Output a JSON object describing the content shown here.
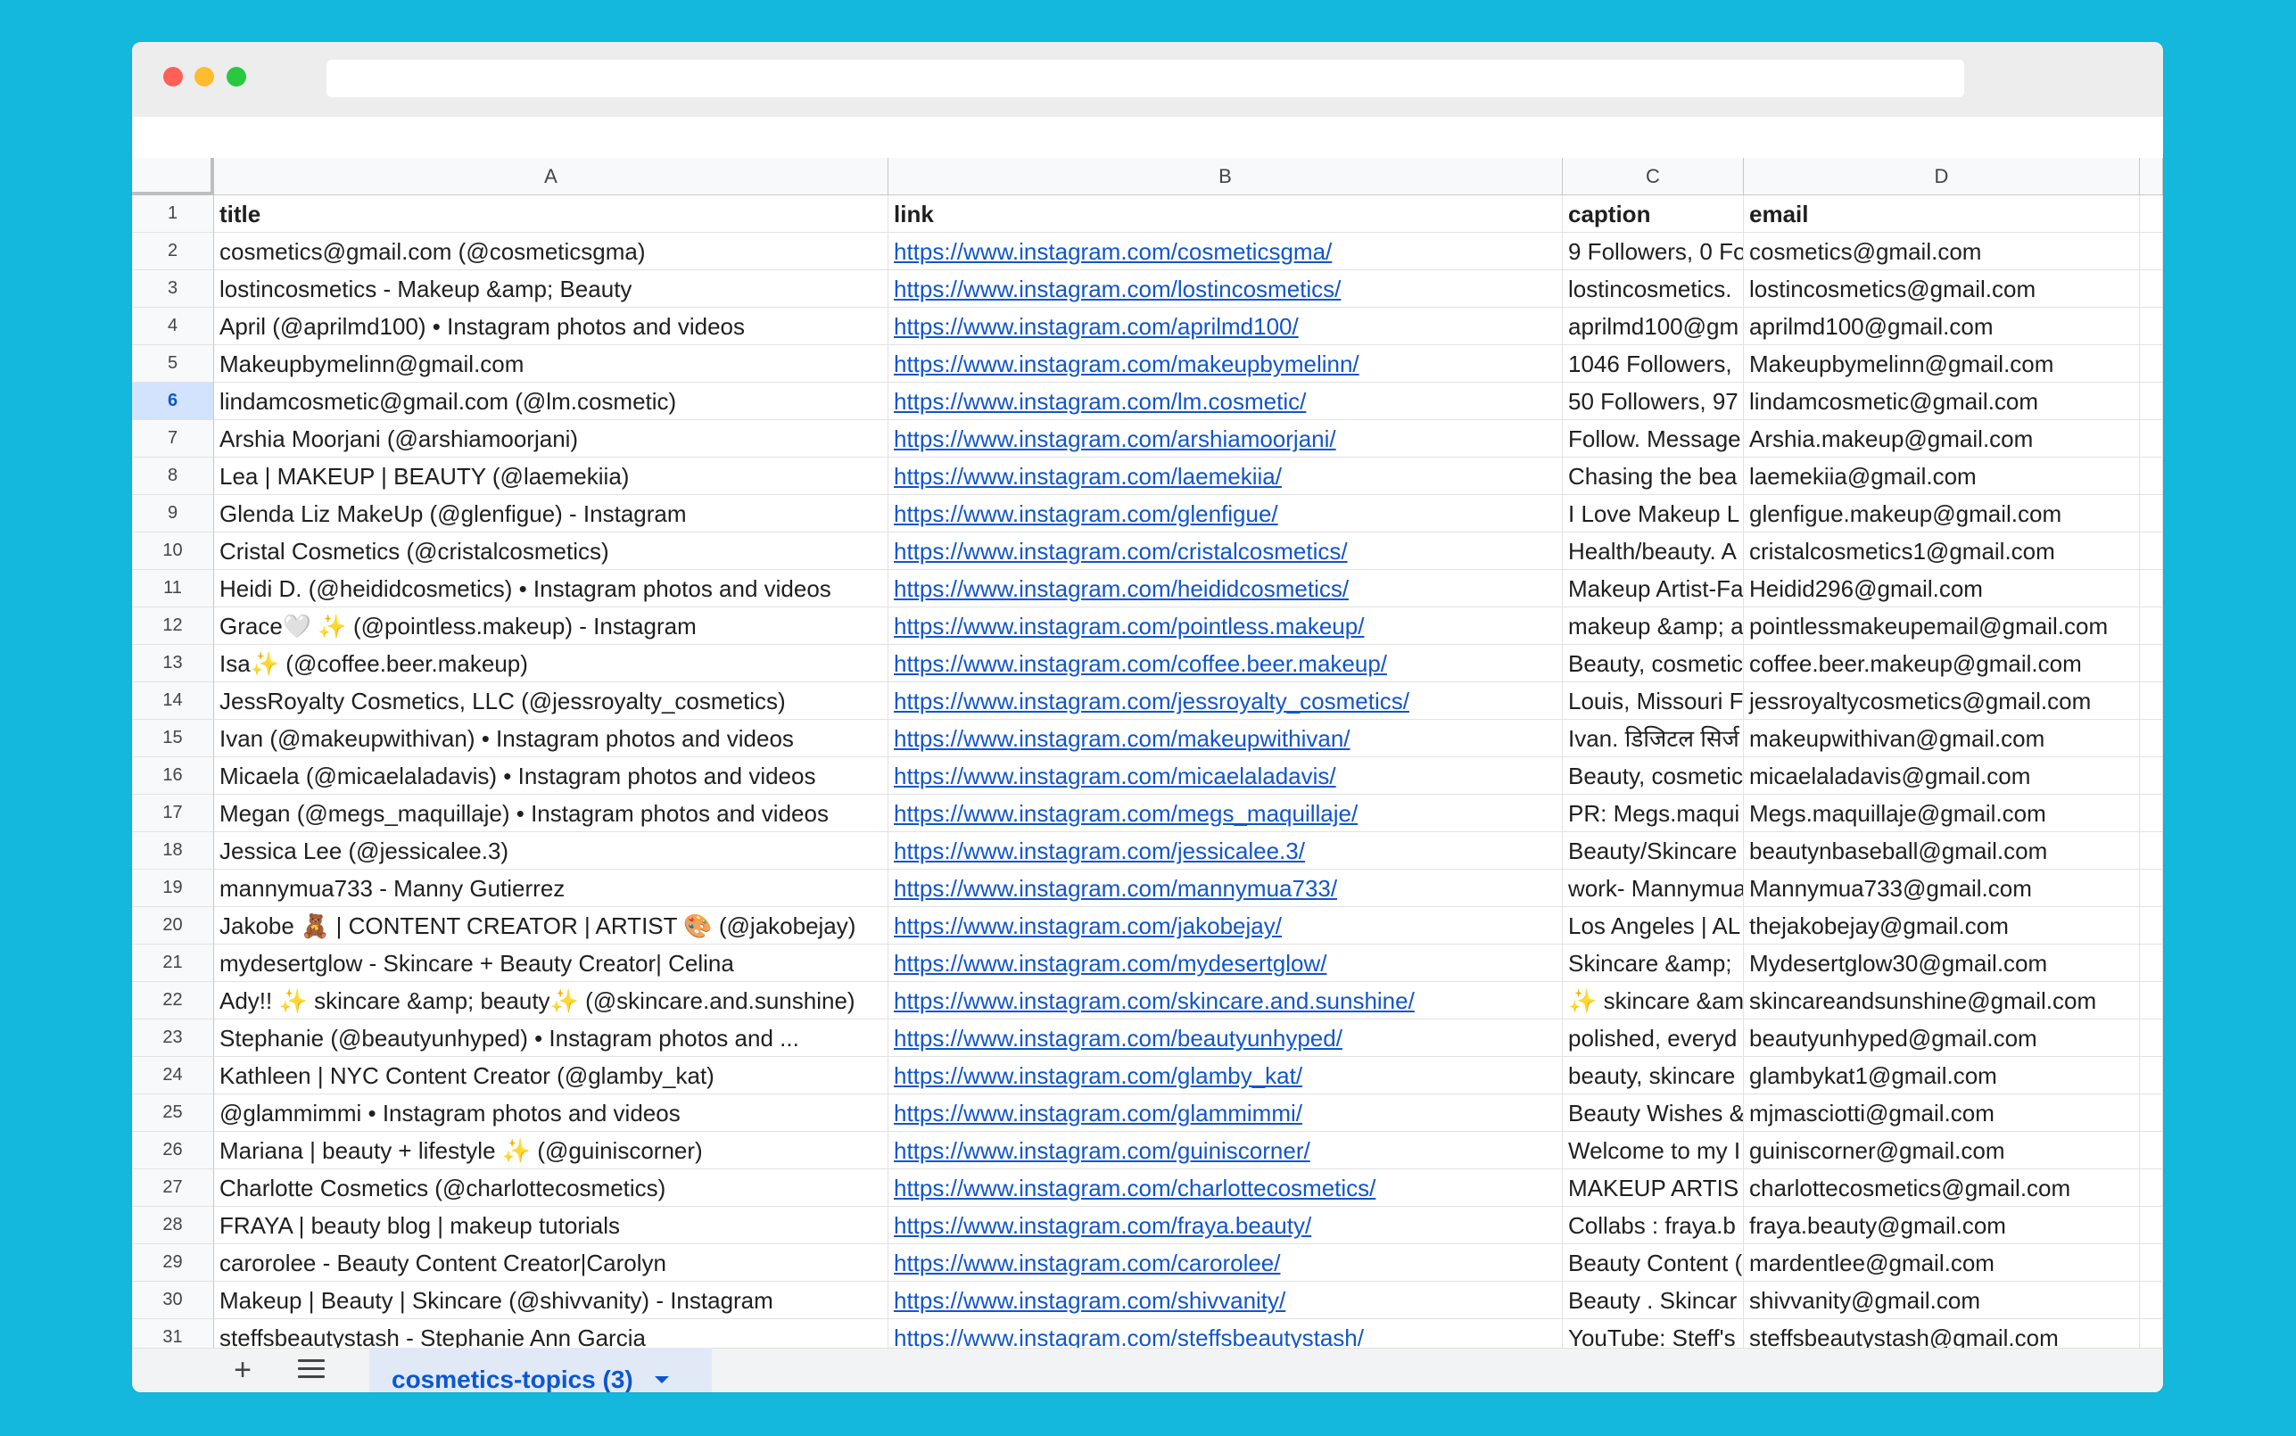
{
  "sheet": {
    "columns": [
      "A",
      "B",
      "C",
      "D"
    ],
    "selected_row": "6",
    "rows": [
      {
        "n": "1",
        "a": "title",
        "b": "link",
        "c": "caption",
        "d": "email"
      },
      {
        "n": "2",
        "a": "cosmetics@gmail.com (@cosmeticsgma)",
        "b": "https://www.instagram.com/cosmeticsgma/",
        "c": "9 Followers, 0 Fo",
        "d": "cosmetics@gmail.com"
      },
      {
        "n": "3",
        "a": "lostincosmetics - Makeup &amp; Beauty",
        "b": "https://www.instagram.com/lostincosmetics/",
        "c": "lostincosmetics.",
        "d": "lostincosmetics@gmail.com"
      },
      {
        "n": "4",
        "a": "April (@aprilmd100) • Instagram photos and videos",
        "b": "https://www.instagram.com/aprilmd100/",
        "c": "aprilmd100@gm",
        "d": "aprilmd100@gmail.com"
      },
      {
        "n": "5",
        "a": "Makeupbymelinn@gmail.com",
        "b": "https://www.instagram.com/makeupbymelinn/",
        "c": "1046 Followers,",
        "d": "Makeupbymelinn@gmail.com"
      },
      {
        "n": "6",
        "a": "lindamcosmetic@gmail.com (@lm.cosmetic)",
        "b": "https://www.instagram.com/lm.cosmetic/",
        "c": "50 Followers, 97",
        "d": "lindamcosmetic@gmail.com"
      },
      {
        "n": "7",
        "a": "Arshia Moorjani (@arshiamoorjani)",
        "b": "https://www.instagram.com/arshiamoorjani/",
        "c": "Follow. Message",
        "d": "Arshia.makeup@gmail.com"
      },
      {
        "n": "8",
        "a": "Lea | MAKEUP | BEAUTY (@laemekiia)",
        "b": "https://www.instagram.com/laemekiia/",
        "c": "Chasing the bea",
        "d": "laemekiia@gmail.com"
      },
      {
        "n": "9",
        "a": "Glenda Liz MakeUp (@glenfigue) - Instagram",
        "b": "https://www.instagram.com/glenfigue/",
        "c": "I Love Makeup L",
        "d": "glenfigue.makeup@gmail.com"
      },
      {
        "n": "10",
        "a": "Cristal Cosmetics (@cristalcosmetics)",
        "b": "https://www.instagram.com/cristalcosmetics/",
        "c": "Health/beauty. A",
        "d": "cristalcosmetics1@gmail.com"
      },
      {
        "n": "11",
        "a": "Heidi D. (@heididcosmetics) • Instagram photos and videos",
        "b": "https://www.instagram.com/heididcosmetics/",
        "c": "Makeup Artist-Fa",
        "d": "Heidid296@gmail.com"
      },
      {
        "n": "12",
        "a": "Grace🤍 ✨ (@pointless.makeup) - Instagram",
        "b": "https://www.instagram.com/pointless.makeup/",
        "c": "makeup &amp; a",
        "d": "pointlessmakeupemail@gmail.com"
      },
      {
        "n": "13",
        "a": "Isa✨ (@coffee.beer.makeup)",
        "b": "https://www.instagram.com/coffee.beer.makeup/",
        "c": "Beauty, cosmetic",
        "d": "coffee.beer.makeup@gmail.com"
      },
      {
        "n": "14",
        "a": "JessRoyalty Cosmetics, LLC (@jessroyalty_cosmetics)",
        "b": "https://www.instagram.com/jessroyalty_cosmetics/",
        "c": "Louis, Missouri F",
        "d": "jessroyaltycosmetics@gmail.com"
      },
      {
        "n": "15",
        "a": "Ivan (@makeupwithivan) • Instagram photos and videos",
        "b": "https://www.instagram.com/makeupwithivan/",
        "c": "Ivan. डिजिटल सिर्ज",
        "d": "makeupwithivan@gmail.com"
      },
      {
        "n": "16",
        "a": "Micaela (@micaelaladavis) • Instagram photos and videos",
        "b": "https://www.instagram.com/micaelaladavis/",
        "c": "Beauty, cosmetic",
        "d": "micaelaladavis@gmail.com"
      },
      {
        "n": "17",
        "a": "Megan (@megs_maquillaje) • Instagram photos and videos",
        "b": "https://www.instagram.com/megs_maquillaje/",
        "c": "PR: Megs.maqui",
        "d": "Megs.maquillaje@gmail.com"
      },
      {
        "n": "18",
        "a": "Jessica Lee (@jessicalee.3)",
        "b": "https://www.instagram.com/jessicalee.3/",
        "c": "Beauty/Skincare",
        "d": "beautynbaseball@gmail.com"
      },
      {
        "n": "19",
        "a": "mannymua733 - Manny Gutierrez",
        "b": "https://www.instagram.com/mannymua733/",
        "c": "work- Mannymua",
        "d": "Mannymua733@gmail.com"
      },
      {
        "n": "20",
        "a": "Jakobe 🧸 | CONTENT CREATOR | ARTIST 🎨 (@jakobejay)",
        "b": "https://www.instagram.com/jakobejay/",
        "c": "Los Angeles | AL",
        "d": "thejakobejay@gmail.com"
      },
      {
        "n": "21",
        "a": "mydesertglow - Skincare + Beauty Creator| Celina",
        "b": "https://www.instagram.com/mydesertglow/",
        "c": "Skincare &amp;",
        "d": "Mydesertglow30@gmail.com"
      },
      {
        "n": "22",
        "a": "Ady!! ✨ skincare &amp; beauty✨ (@skincare.and.sunshine)",
        "b": "https://www.instagram.com/skincare.and.sunshine/",
        "c": "✨ skincare &am",
        "d": "skincareandsunshine@gmail.com"
      },
      {
        "n": "23",
        "a": "Stephanie (@beautyunhyped) • Instagram photos and ...",
        "b": "https://www.instagram.com/beautyunhyped/",
        "c": "polished, everyd",
        "d": "beautyunhyped@gmail.com"
      },
      {
        "n": "24",
        "a": "Kathleen | NYC Content Creator (@glamby_kat)",
        "b": "https://www.instagram.com/glamby_kat/",
        "c": "beauty, skincare",
        "d": "glambykat1@gmail.com"
      },
      {
        "n": "25",
        "a": "@glammimmi • Instagram photos and videos",
        "b": "https://www.instagram.com/glammimmi/",
        "c": "Beauty Wishes &",
        "d": "mjmasciotti@gmail.com"
      },
      {
        "n": "26",
        "a": "Mariana | beauty + lifestyle ✨ (@guiniscorner)",
        "b": "https://www.instagram.com/guiniscorner/",
        "c": "Welcome to my I",
        "d": "guiniscorner@gmail.com"
      },
      {
        "n": "27",
        "a": "Charlotte Cosmetics (@charlottecosmetics)",
        "b": "https://www.instagram.com/charlottecosmetics/",
        "c": "MAKEUP ARTIS",
        "d": "charlottecosmetics@gmail.com"
      },
      {
        "n": "28",
        "a": "FRAYA | beauty blog | makeup tutorials",
        "b": "https://www.instagram.com/fraya.beauty/",
        "c": "Collabs : fraya.b",
        "d": "fraya.beauty@gmail.com"
      },
      {
        "n": "29",
        "a": "carorolee - Beauty Content Creator|Carolyn",
        "b": "https://www.instagram.com/carorolee/",
        "c": "Beauty Content (",
        "d": "mardentlee@gmail.com"
      },
      {
        "n": "30",
        "a": "Makeup | Beauty | Skincare (@shivvanity) - Instagram",
        "b": "https://www.instagram.com/shivvanity/",
        "c": "Beauty . Skincar",
        "d": "shivvanity@gmail.com"
      },
      {
        "n": "31",
        "a": "steffsbeautystash - Stephanie Ann Garcia",
        "b": "https://www.instagram.com/steffsbeautystash/",
        "c": "YouTube: Steff's",
        "d": "steffsbeautystash@gmail.com"
      }
    ]
  },
  "footer": {
    "add_sheet_label": "+",
    "sheet_tab_label": "cosmetics-topics (3)"
  },
  "colors": {
    "background": "#14b8dc",
    "link": "#1155cc",
    "selected_tab": "#0b57d0"
  }
}
